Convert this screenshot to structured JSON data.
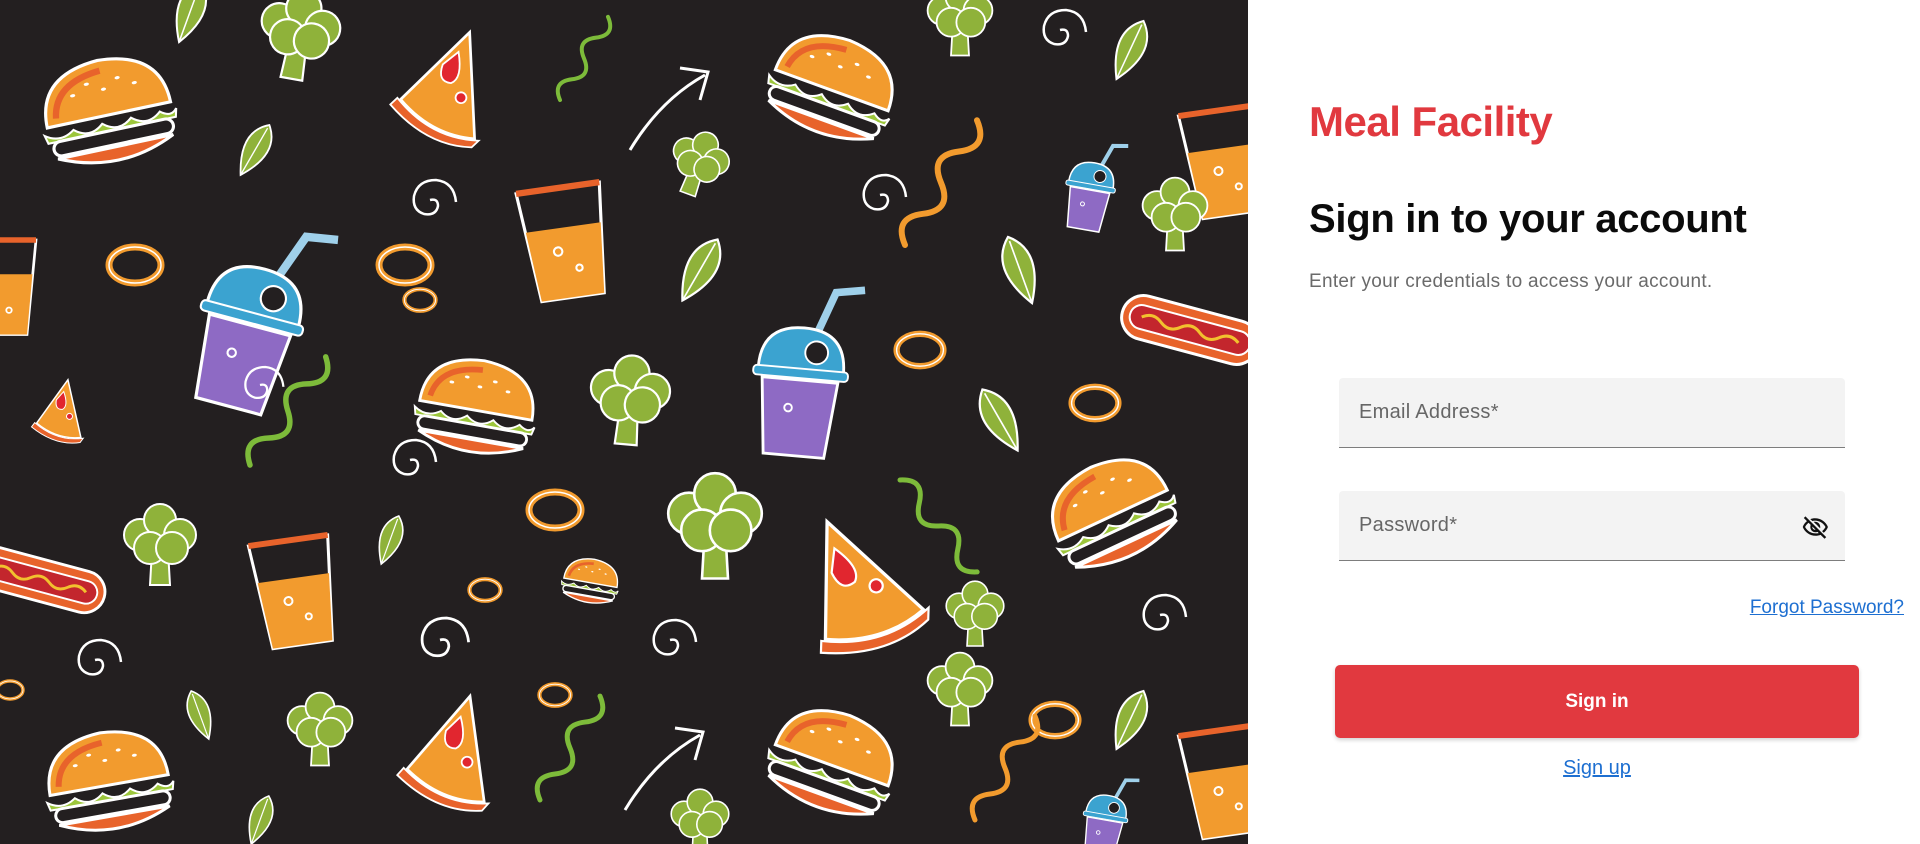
{
  "brand": {
    "name": "Meal Facility",
    "color": "#e1393f"
  },
  "login": {
    "heading": "Sign in to your account",
    "subtitle": "Enter your credentials to access your account.",
    "email": {
      "placeholder": "Email Address*",
      "value": ""
    },
    "password": {
      "placeholder": "Password*",
      "value": "",
      "toggle_icon": "eye-off-icon"
    },
    "forgot_label": "Forgot Password?",
    "submit_label": "Sign in",
    "signup_label": "Sign up"
  },
  "background": {
    "pattern": "food-doodle-pattern",
    "base_color": "#231f20",
    "items": [
      "burger",
      "pizza-slice",
      "drink-cup",
      "smoothie-cup",
      "hot-dog",
      "onion-ring",
      "leaf",
      "broccoli",
      "arrow",
      "squiggle"
    ]
  },
  "colors": {
    "link": "#1d6fd1",
    "accent": "#e1393f"
  }
}
